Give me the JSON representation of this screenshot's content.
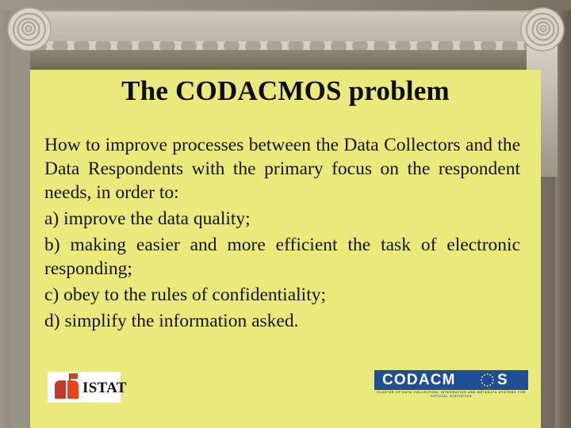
{
  "slide": {
    "title": "The CODACMOS problem",
    "intro": "How to improve processes between the Data Collectors and the Data Respondents with the primary focus on the respondent needs, in order to:",
    "items": [
      "a) improve the data quality;",
      "b) making easier and more efficient the task of electronic responding;",
      "c) obey to the rules of confidentiality;",
      "d) simplify the information asked."
    ],
    "logos": {
      "istat": {
        "name": "ISTAT",
        "wordmark": "ISTAT"
      },
      "codacmos": {
        "name": "CODACMOS",
        "wordmark_before": "CODACM",
        "wordmark_after": "S",
        "tagline": "Cluster of data collection, integration and metadata systems for official statistics"
      }
    },
    "colors": {
      "panel": "#e9e97c",
      "frame": "#8b8678",
      "stone": "#cfcbc0",
      "entablature": "#7e7764",
      "codacmos_blue": "#1d4e96",
      "istat_red": "#d94126",
      "text": "#141410"
    }
  }
}
